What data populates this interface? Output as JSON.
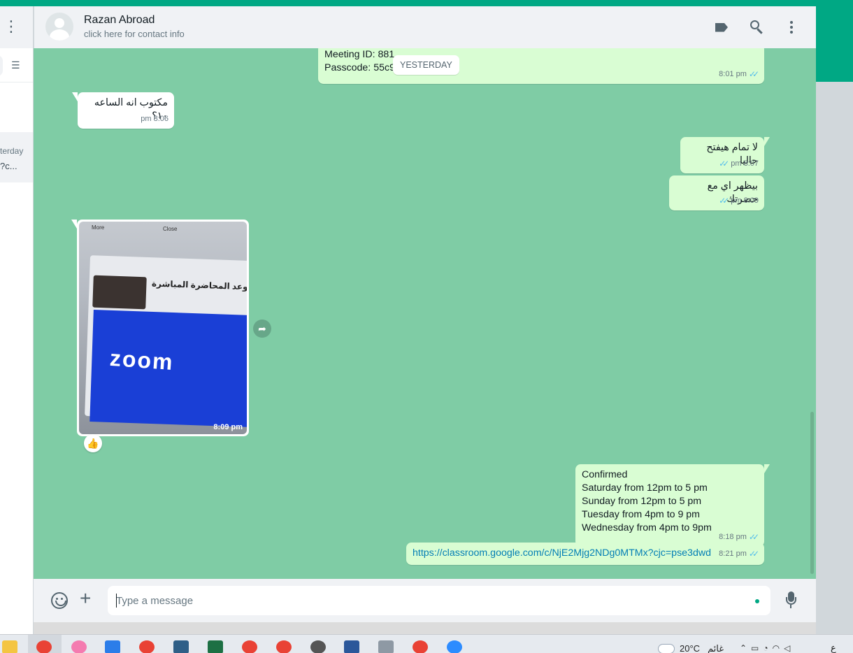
{
  "contact": {
    "name": "Razan Abroad",
    "subtitle": "click here for contact info"
  },
  "sidebar": {
    "chat_preview_time": "terday",
    "chat_preview_text": "?c..."
  },
  "day_chip": "YESTERDAY",
  "messages": {
    "m1": {
      "lines": [
        "Meeting ID: 881",
        "Passcode: 55c9q"
      ],
      "time": "8:01 pm"
    },
    "m2": {
      "text": "مكتوب انه الساعه ١٠؟",
      "time": "8:06 pm"
    },
    "m3": {
      "text": "لا تمام هيفتح حاليا",
      "time": "8:07 pm"
    },
    "m4": {
      "text": "بيظهر اي مع حضرتك",
      "time": "8:09 pm"
    },
    "photo": {
      "time": "8:09 pm",
      "reaction": "👍",
      "caption_top_left": "More",
      "caption_top_right": "Close",
      "meeting_title": "موعد المحاضرة المباشرة",
      "brand": "zoom"
    },
    "m5": {
      "lines": [
        "Confirmed",
        "Saturday from 12pm to 5 pm",
        "Sunday from 12pm to 5 pm",
        "Tuesday from 4pm to 9 pm",
        "Wednesday from 4pm to 9pm"
      ],
      "time": "8:18 pm"
    },
    "m6": {
      "link": "https://classroom.google.com/c/NjE2Mjg2NDg0MTMx?cjc=pse3dwd",
      "time": "8:21 pm"
    }
  },
  "composer": {
    "placeholder": "Type a message"
  },
  "taskbar": {
    "temperature": "20°C",
    "weather_text": "غائم",
    "lang": "ع",
    "apps": [
      "file-explorer",
      "chrome",
      "paint",
      "photos",
      "chrome",
      "vscode",
      "excel",
      "chrome",
      "chrome",
      "settings",
      "word",
      "calculator",
      "chrome",
      "zoom"
    ]
  },
  "colors": {
    "accent": "#00a884",
    "chat_bg": "#7fcca5",
    "outgoing_bubble": "#d9fdd3",
    "incoming_bubble": "#ffffff",
    "read_ticks": "#53bdeb"
  }
}
